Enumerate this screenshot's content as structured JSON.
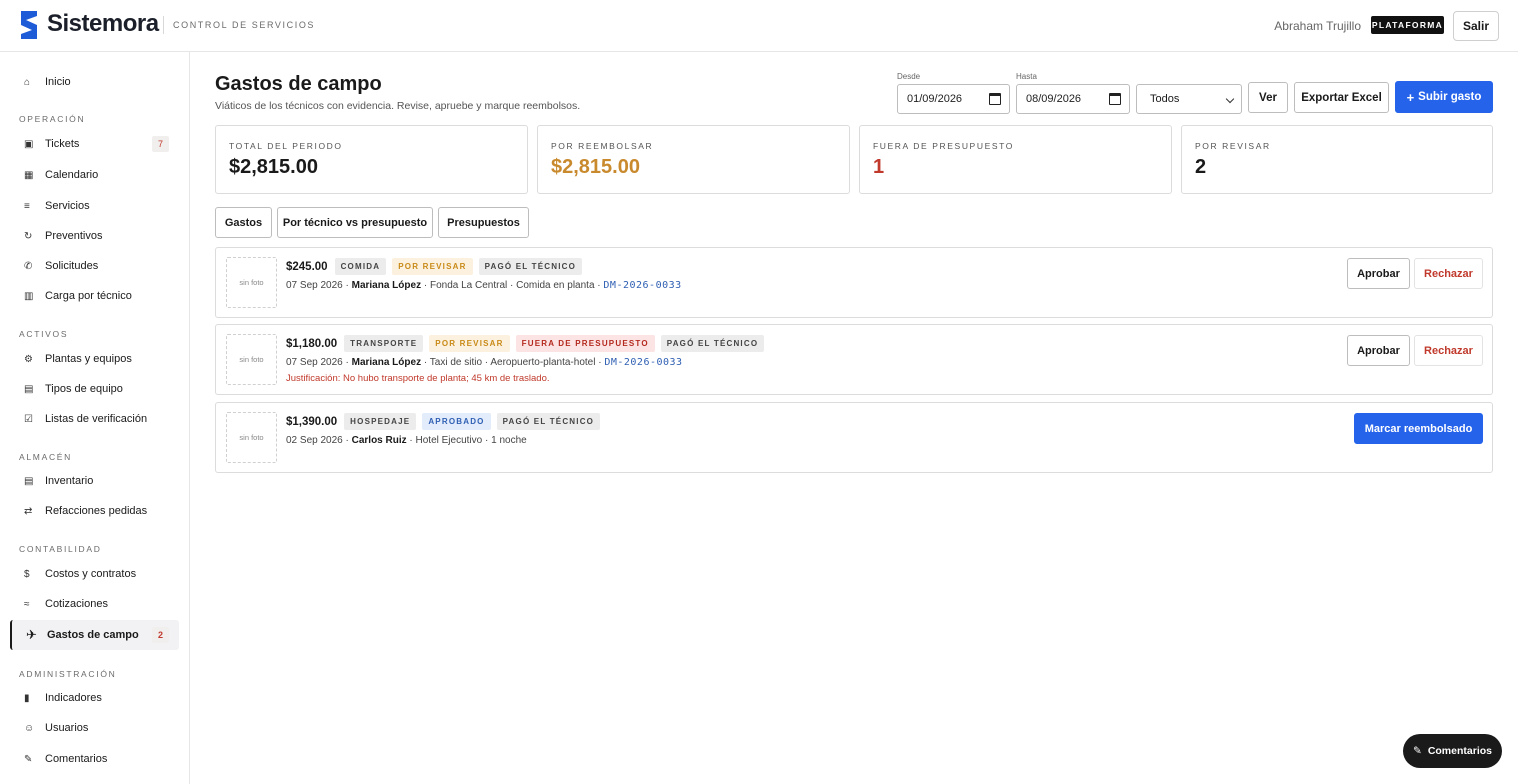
{
  "header": {
    "brand": "Sistemora",
    "subtitle": "CONTROL DE SERVICIOS",
    "user": "Abraham Trujillo",
    "badge": "PLATAFORMA",
    "logout": "Salir"
  },
  "sidebar": {
    "home": {
      "label": "Inicio",
      "icon": "home-icon"
    },
    "sections": {
      "operacion": "OPERACIÓN",
      "activos": "ACTIVOS",
      "almacen": "ALMACÉN",
      "contabilidad": "CONTABILIDAD",
      "administracion": "ADMINISTRACIÓN"
    },
    "items": {
      "tickets": {
        "label": "Tickets",
        "count": "7"
      },
      "calendario": {
        "label": "Calendario"
      },
      "servicios": {
        "label": "Servicios"
      },
      "preventivos": {
        "label": "Preventivos"
      },
      "solicitudes": {
        "label": "Solicitudes"
      },
      "carga": {
        "label": "Carga por técnico"
      },
      "plantas": {
        "label": "Plantas y equipos"
      },
      "tipos": {
        "label": "Tipos de equipo"
      },
      "listas": {
        "label": "Listas de verificación"
      },
      "inventario": {
        "label": "Inventario"
      },
      "refacciones": {
        "label": "Refacciones pedidas"
      },
      "costos": {
        "label": "Costos y contratos"
      },
      "cotizaciones": {
        "label": "Cotizaciones"
      },
      "gastos": {
        "label": "Gastos de campo",
        "count": "2"
      },
      "indicadores": {
        "label": "Indicadores"
      },
      "usuarios": {
        "label": "Usuarios"
      },
      "comentarios": {
        "label": "Comentarios"
      }
    }
  },
  "page": {
    "title": "Gastos de campo",
    "subtitle": "Viáticos de los técnicos con evidencia. Revise, apruebe y marque reembolsos."
  },
  "filters": {
    "from_label": "Desde",
    "from_value": "01/09/2026",
    "to_label": "Hasta",
    "to_value": "08/09/2026",
    "status_value": "Todos",
    "view_button": "Ver",
    "export_button": "Exportar Excel",
    "upload_button": "Subir gasto"
  },
  "stats": [
    {
      "label": "TOTAL DEL PERIODO",
      "value": "$2,815.00",
      "color": "#1a1a1a"
    },
    {
      "label": "POR REEMBOLSAR",
      "value": "$2,815.00",
      "color": "#c98a2e"
    },
    {
      "label": "FUERA DE PRESUPUESTO",
      "value": "1",
      "color": "#c0392b"
    },
    {
      "label": "POR REVISAR",
      "value": "2",
      "color": "#1a1a1a"
    }
  ],
  "tabs": [
    "Gastos",
    "Por técnico vs presupuesto",
    "Presupuestos"
  ],
  "expenses": [
    {
      "thumb": "sin foto",
      "amount": "$245.00",
      "category": "COMIDA",
      "status": "POR REVISAR",
      "payer": "PAGÓ EL TÉCNICO",
      "date": "07 Sep 2026 ·",
      "tech": "Mariana López",
      "detail": "· Fonda La Central · Comida en planta ·",
      "ref": "DM-2026-0033",
      "approve": "Aprobar",
      "reject": "Rechazar"
    },
    {
      "thumb": "sin foto",
      "amount": "$1,180.00",
      "category": "TRANSPORTE",
      "status": "POR REVISAR",
      "budget": "FUERA DE PRESUPUESTO",
      "payer": "PAGÓ EL TÉCNICO",
      "date": "07 Sep 2026 ·",
      "tech": "Mariana López",
      "detail": "· Taxi de sitio · Aeropuerto-planta-hotel ·",
      "ref": "DM-2026-0033",
      "justification": "Justificación: No hubo transporte de planta; 45 km de traslado.",
      "approve": "Aprobar",
      "reject": "Rechazar"
    },
    {
      "thumb": "sin foto",
      "amount": "$1,390.00",
      "category": "HOSPEDAJE",
      "status": "APROBADO",
      "payer": "PAGÓ EL TÉCNICO",
      "date": "02 Sep 2026 ·",
      "tech": "Carlos Ruiz",
      "detail": "· Hotel Ejecutivo · 1 noche",
      "reimburse": "Marcar reembolsado"
    }
  ],
  "fab": {
    "label": "Comentarios",
    "icon": "pencil-icon"
  }
}
